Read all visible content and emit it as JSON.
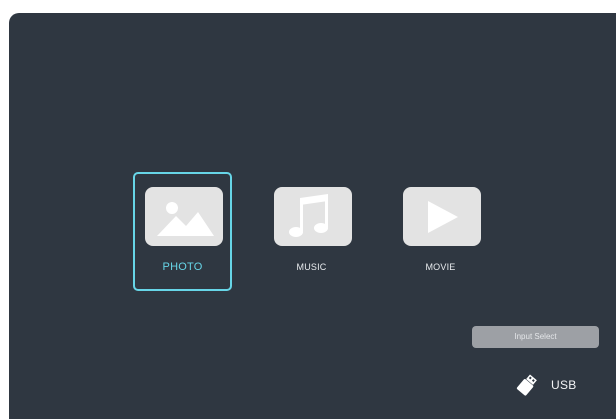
{
  "menu": {
    "items": [
      {
        "id": "photo",
        "label": "PHOTO",
        "icon": "photo-icon",
        "selected": true
      },
      {
        "id": "music",
        "label": "MUSIC",
        "icon": "music-note-icon",
        "selected": false
      },
      {
        "id": "movie",
        "label": "MOVIE",
        "icon": "play-icon",
        "selected": false
      }
    ]
  },
  "input_select": {
    "label": "Input Select"
  },
  "source": {
    "label": "USB",
    "icon": "usb-drive-icon"
  },
  "colors": {
    "background": "#2f3741",
    "selection": "#67d5e7",
    "icon_tile": "#e3e3e3",
    "button": "#9da0a5"
  }
}
